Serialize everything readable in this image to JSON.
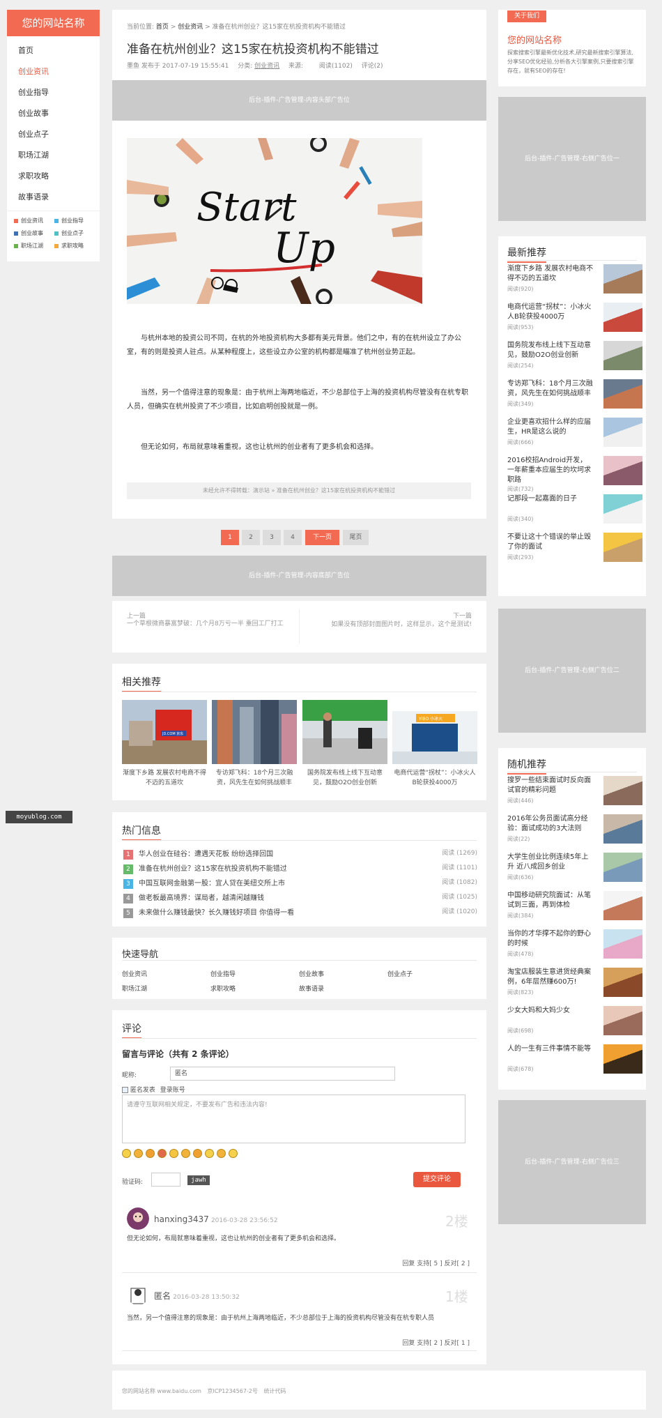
{
  "site": {
    "name": "您的网站名称"
  },
  "nav": [
    {
      "label": "首页",
      "active": false
    },
    {
      "label": "创业资讯",
      "active": true
    },
    {
      "label": "创业指导",
      "active": false
    },
    {
      "label": "创业故事",
      "active": false
    },
    {
      "label": "创业点子",
      "active": false
    },
    {
      "label": "职场江湖",
      "active": false
    },
    {
      "label": "求职攻略",
      "active": false
    },
    {
      "label": "故事语录",
      "active": false
    }
  ],
  "nav_tags": [
    {
      "color": "#f36a52",
      "label": "创业资讯"
    },
    {
      "color": "#4ab4e6",
      "label": "创业指导"
    },
    {
      "color": "#3f6fb4",
      "label": "创业故事"
    },
    {
      "color": "#4fc0c8",
      "label": "创业点子"
    },
    {
      "color": "#6ab04c",
      "label": "职场江湖"
    },
    {
      "color": "#f3a83b",
      "label": "求职攻略"
    }
  ],
  "article": {
    "crumb_prefix": "当前位置:",
    "crumb_home": "首页",
    "crumb_sep1": ">",
    "crumb_cat": "创业资讯",
    "crumb_sep2": ">",
    "crumb_current": "准备在杭州创业？这15家在杭投资机构不能错过",
    "title": "准备在杭州创业？这15家在杭投资机构不能错过",
    "author": "墨鱼 发布于 2017-07-19 15:55:41",
    "cat_label": "分类:",
    "cat": "创业资讯",
    "source_label": "来源:",
    "views": "阅读(1102)",
    "comments": "评论(2)",
    "top_ad": "后台-插件-广告管理-内容头部广告位",
    "image_text_1": "Start",
    "image_text_2": "Up",
    "paragraphs": [
      "与杭州本地的投资公司不同，在杭的外地投资机构大多都有美元背景。他们之中，有的在杭州设立了办公室，有的则是投资人驻点。从某种程度上，这些设立办公室的机构都是瞄准了杭州创业势正起。",
      "当然，另一个值得注意的现象是：由于杭州上海两地临近，不少总部位于上海的投资机构尽管没有在杭专职人员，但确实在杭州投资了不少项目，比如启明创投就是一例。",
      "但无论如何，布局就意味着重视，这也让杭州的创业者有了更多机会和选择。"
    ],
    "copyright": "未经允许不得转载：演示站 » 准备在杭州创业？这15家在杭投资机构不能错过"
  },
  "pagination": {
    "pages": [
      "1",
      "2",
      "3",
      "4"
    ],
    "next": "下一页",
    "last": "尾页"
  },
  "bottom_ad": "后台-插件-广告管理-内容底部广告位",
  "prevnext": {
    "prev_label": "上一篇",
    "prev_title": "一个草根微商暴富梦破：几个月8万亏一半 重回工厂打工",
    "next_label": "下一篇",
    "next_title": "如果没有顶部封面图片时，这样显示，这个是测试!"
  },
  "related": {
    "title": "相关推荐",
    "items": [
      {
        "caption": "渐度下乡路 发展农村电商不得不迈的五道坎",
        "sign": "JD.COM 京东"
      },
      {
        "caption": "专访郑飞科：18个月三次融资，风先生在如何挑战顺丰"
      },
      {
        "caption": "国务院发布线上线下互动意见，鼓励O2O创业创新"
      },
      {
        "caption": "电商代运营“拐杖”：小冰火人B轮获投4000万",
        "sign": "YIBO 小冰火"
      }
    ]
  },
  "hot": {
    "title": "热门信息",
    "items": [
      {
        "num": "1",
        "color": "#e57373",
        "title": "华人创业在硅谷：遭遇天花板 纷纷选择回国",
        "reads": "阅读 (1269)"
      },
      {
        "num": "2",
        "color": "#66bb6a",
        "title": "准备在杭州创业？这15家在杭投资机构不能错过",
        "reads": "阅读 (1101)"
      },
      {
        "num": "3",
        "color": "#4ab4e6",
        "title": "中国互联网金融第一股：宜人贷在美纽交所上市",
        "reads": "阅读 (1082)"
      },
      {
        "num": "4",
        "color": "#999999",
        "title": "做老板最高境界：谋局者，越清闲越赚钱",
        "reads": "阅读 (1025)"
      },
      {
        "num": "5",
        "color": "#999999",
        "title": "未来做什么赚钱最快？长久赚钱好项目 你值得一看",
        "reads": "阅读 (1020)"
      }
    ]
  },
  "quicknav": {
    "title": "快速导航",
    "items": [
      "创业资讯",
      "创业指导",
      "创业故事",
      "创业点子",
      "职场江湖",
      "求职攻略",
      "故事语录"
    ]
  },
  "comments": {
    "title": "评论",
    "heading": "留言与评论（共有 2 条评论）",
    "nick_label": "昵称:",
    "nick_value": "匿名",
    "anon_label": "匿名发表",
    "login_label": "登录账号",
    "textarea_placeholder": "请遵守互联网相关规定，不要发布广告和违法内容!",
    "captcha_label": "验证码:",
    "captcha_code": "jawh",
    "submit": "提交评论",
    "list": [
      {
        "user": "hanxing3437",
        "time": "2016-03-28 23:56:52",
        "floor": "2楼",
        "text": "但无论如何，布局就意味着重视，这也让杭州的创业者有了更多机会和选择。",
        "actions": "回复 支持[ 5 ] 反对[ 2 ]"
      },
      {
        "user": "匿名",
        "time": "2016-03-28 13:50:32",
        "floor": "1楼",
        "text": "当然，另一个值得注意的现象是：由于杭州上海两地临近，不少总部位于上海的投资机构尽管没有在杭专职人员",
        "actions": "回复 支持[ 2 ] 反对[ 1 ]"
      }
    ]
  },
  "footer": {
    "site": "您的网站名称 www.baidu.com",
    "icp": "京ICP1234567-2号",
    "stats": "统计代码"
  },
  "watermark": "moyublog.com",
  "sidebar": {
    "about": {
      "tab": "关于我们",
      "name": "您的网站名称",
      "desc": "探索搜索引擎最新优化技术,研究最新搜索引擎算法,分享SEO优化经验,分析各大引擎案例,只要搜索引擎存在，就有SEO的存在!"
    },
    "ad1": "后台-插件-广告管理-右侧广告位一",
    "ad2": "后台-插件-广告管理-右侧广告位二",
    "ad3": "后台-插件-广告管理-右侧广告位三",
    "latest": {
      "title": "最新推荐",
      "items": [
        {
          "title": "渐度下乡路 发展农村电商不得不迈的五道坎",
          "reads": "阅读(920)"
        },
        {
          "title": "电商代运营“拐杖”：小冰火人B轮获投4000万",
          "reads": "阅读(953)"
        },
        {
          "title": "国务院发布线上线下互动意见，鼓励O2O创业创新",
          "reads": "阅读(254)"
        },
        {
          "title": "专访郑飞科：18个月三次融资，风先生在如何挑战顺丰",
          "reads": "阅读(349)"
        },
        {
          "title": "企业更喜欢招什么样的应届生，HR是这么说的",
          "reads": "阅读(666)"
        },
        {
          "title": "2016校招Android开发，一年薪重本应届生的坎坷求职路",
          "reads": "阅读(732)"
        },
        {
          "title": "记那段一起嘉面的日子",
          "reads": "阅读(340)"
        },
        {
          "title": "不要让这十个错误的举止毁了你的面试",
          "reads": "阅读(293)"
        }
      ]
    },
    "random": {
      "title": "随机推荐",
      "items": [
        {
          "title": "搜罗一些结束面试时反向面试官的精彩问题",
          "reads": "阅读(446)"
        },
        {
          "title": "2016年公务员面试高分经验：面试成功的3大法则",
          "reads": "阅读(22)"
        },
        {
          "title": "大学生创业比例连续5年上升 近八成回乡创业",
          "reads": "阅读(636)"
        },
        {
          "title": "中国移动研究院面试：从笔试到三面，再到体检",
          "reads": "阅读(384)"
        },
        {
          "title": "当你的才华撑不起你的野心的时候",
          "reads": "阅读(478)"
        },
        {
          "title": "淘宝店服装生意进货经典案例，6年层然赚600万!",
          "reads": "阅读(823)"
        },
        {
          "title": "少女大妈和大妈少女",
          "reads": "阅读(698)"
        },
        {
          "title": "人的一生有三件事情不能等",
          "reads": "阅读(678)"
        }
      ]
    }
  }
}
